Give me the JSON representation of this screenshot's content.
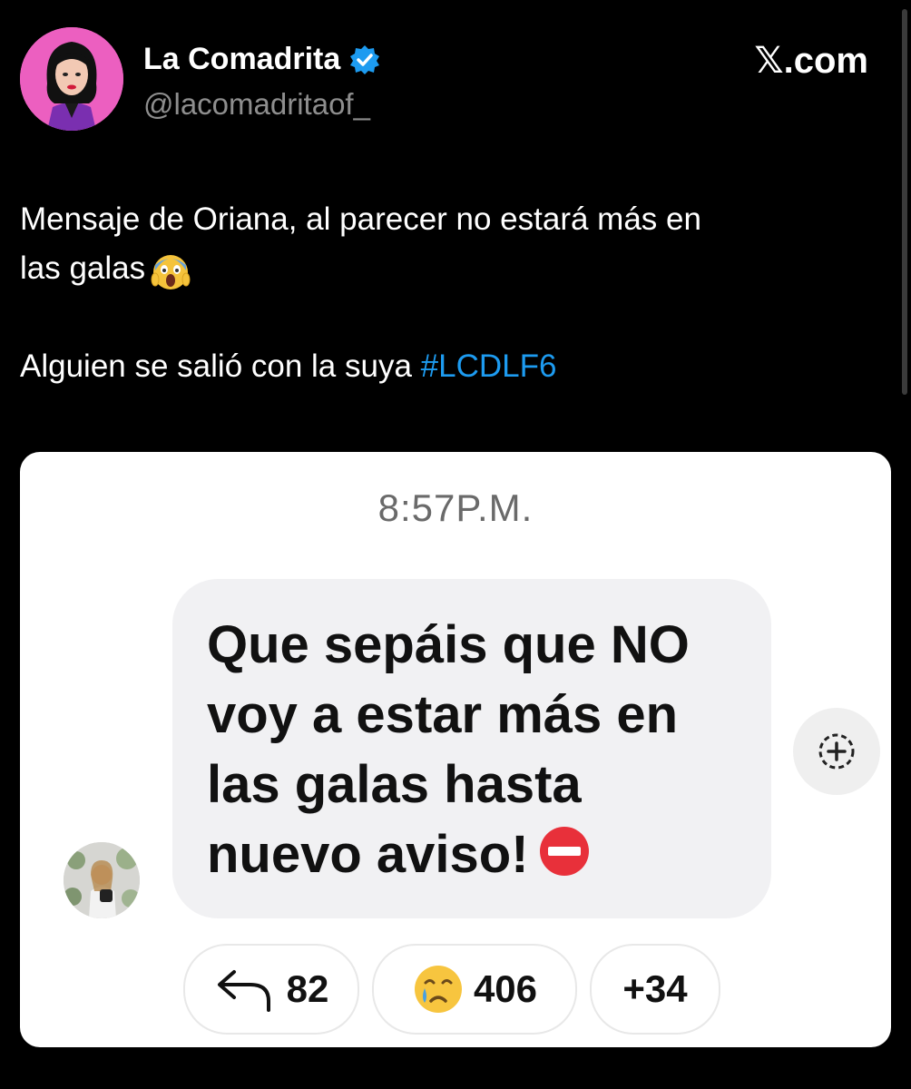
{
  "header": {
    "display_name": "La Comadrita",
    "handle": "@lacomadritaof_",
    "brand": "𝕏.com",
    "colors": {
      "verified": "#1d9bf0",
      "avatar_bg": "#ec5fc0"
    }
  },
  "tweet": {
    "line1": "Mensaje de Oriana, al parecer no estará más en",
    "line2": "las galas",
    "line2_emoji": "face-screaming-in-fear",
    "line3": "Alguien se salió con la suya",
    "hashtag": "#LCDLF6",
    "colors": {
      "hashtag": "#1d9bf0"
    }
  },
  "message_card": {
    "time": "8:57P.M.",
    "bubble_lines": [
      "Que sepáis que NO",
      "voy a estar más en",
      "las galas hasta",
      "nuevo aviso!"
    ],
    "bubble_emoji": "no-entry",
    "add_reaction_icon": "add-reaction-icon",
    "pills": [
      {
        "icon": "reply-arrow-icon",
        "count": "82"
      },
      {
        "icon": "crying-face-icon",
        "count": "406"
      },
      {
        "icon": "",
        "count": "+34"
      }
    ]
  }
}
